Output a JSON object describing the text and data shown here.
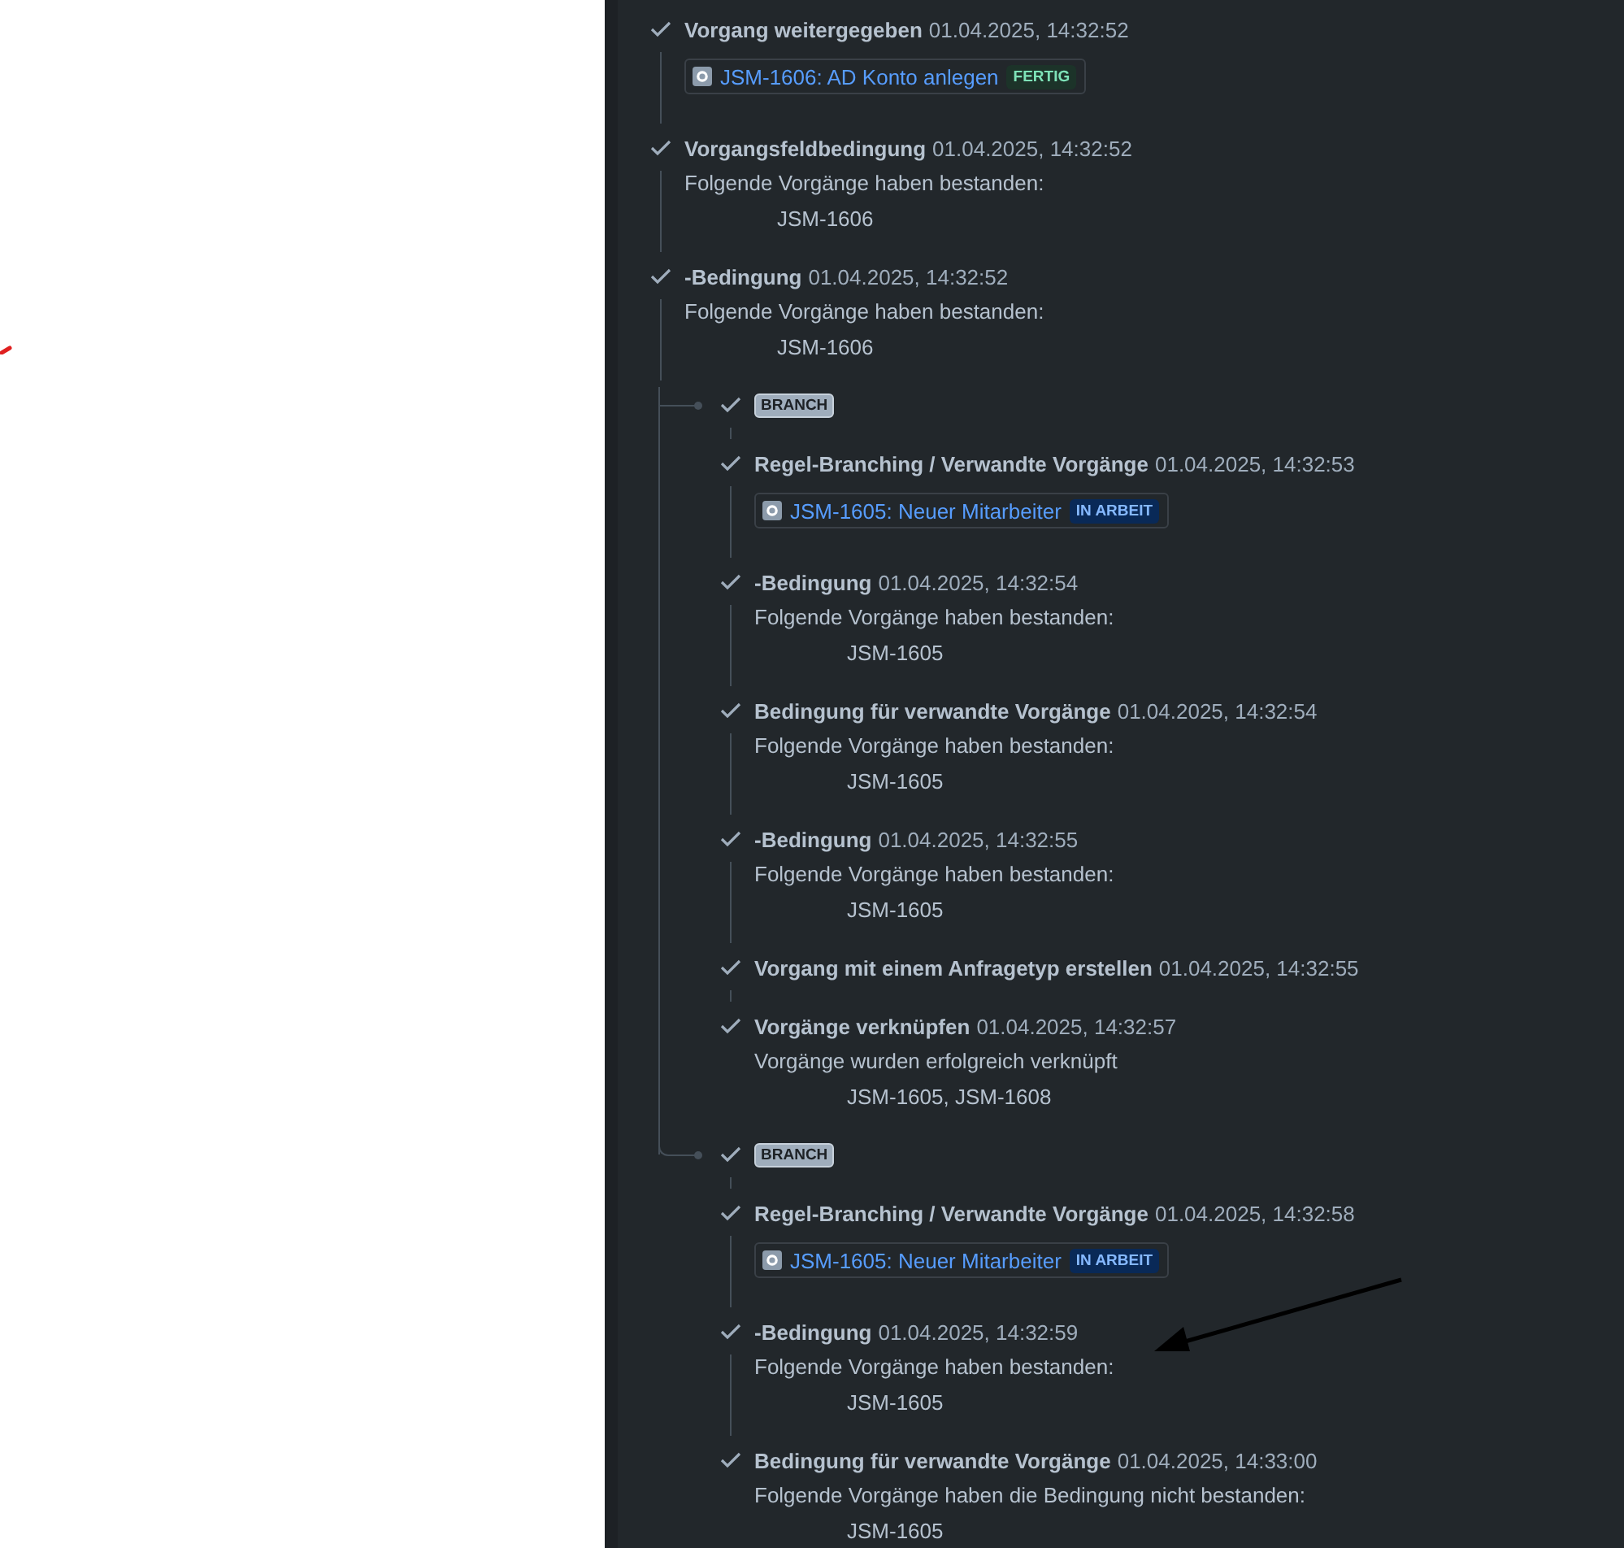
{
  "log": [
    {
      "kind": "entry",
      "title": "Vorgang weitergegeben",
      "time": "01.04.2025, 14:32:52",
      "issue": {
        "label": "JSM-1606: AD Konto anlegen",
        "status": "FERTIG",
        "color": "#1c3329"
      }
    },
    {
      "kind": "entry",
      "title": "Vorgangsfeldbedingung",
      "time": "01.04.2025, 14:32:52",
      "message": "Folgende Vorgänge haben bestanden:",
      "keys": "JSM-1606"
    },
    {
      "kind": "entry",
      "title": "-Bedingung",
      "time": "01.04.2025, 14:32:52",
      "message": "Folgende Vorgänge haben bestanden:",
      "keys": "JSM-1606"
    },
    {
      "kind": "branch",
      "label": "BRANCH",
      "children": [
        {
          "kind": "entry",
          "title": "Regel-Branching / Verwandte Vorgänge",
          "time": "01.04.2025, 14:32:53",
          "issue": {
            "label": "JSM-1605: Neuer Mitarbeiter",
            "status": "IN ARBEIT",
            "color": "#092957"
          }
        },
        {
          "kind": "entry",
          "title": "-Bedingung",
          "time": "01.04.2025, 14:32:54",
          "message": "Folgende Vorgänge haben bestanden:",
          "keys": "JSM-1605"
        },
        {
          "kind": "entry",
          "title": "Bedingung für verwandte Vorgänge",
          "time": "01.04.2025, 14:32:54",
          "message": "Folgende Vorgänge haben bestanden:",
          "keys": "JSM-1605"
        },
        {
          "kind": "entry",
          "title": "-Bedingung",
          "time": "01.04.2025, 14:32:55",
          "message": "Folgende Vorgänge haben bestanden:",
          "keys": "JSM-1605"
        },
        {
          "kind": "entry",
          "title": "Vorgang mit einem Anfragetyp erstellen",
          "time": "01.04.2025, 14:32:55"
        },
        {
          "kind": "entry",
          "title": "Vorgänge verknüpfen",
          "time": "01.04.2025, 14:32:57",
          "message": "Vorgänge wurden erfolgreich verknüpft",
          "keys": "JSM-1605, JSM-1608"
        }
      ]
    },
    {
      "kind": "branch",
      "label": "BRANCH",
      "children": [
        {
          "kind": "entry",
          "title": "Regel-Branching / Verwandte Vorgänge",
          "time": "01.04.2025, 14:32:58",
          "issue": {
            "label": "JSM-1605: Neuer Mitarbeiter",
            "status": "IN ARBEIT",
            "color": "#092957"
          }
        },
        {
          "kind": "entry",
          "title": "-Bedingung",
          "time": "01.04.2025, 14:32:59",
          "message": "Folgende Vorgänge haben bestanden:",
          "keys": "JSM-1605"
        },
        {
          "kind": "entry",
          "title": "Bedingung für verwandte Vorgänge",
          "time": "01.04.2025, 14:33:00",
          "message": "Folgende Vorgänge haben die Bedingung nicht bestanden:",
          "keys": "JSM-1605"
        }
      ]
    }
  ]
}
